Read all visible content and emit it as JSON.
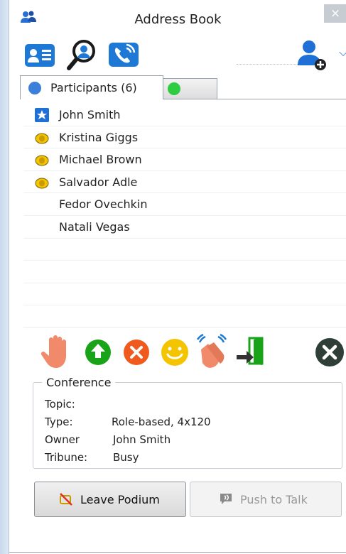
{
  "window": {
    "title": "Address Book",
    "close_label": "×"
  },
  "toolbar": {
    "buttons": [
      "contacts-card-icon",
      "search-icon",
      "call-icon"
    ],
    "add_user_icon": "add-user-icon",
    "dropdown_icon": "chevron-down-icon"
  },
  "tabs": [
    {
      "label": "Participants (6)",
      "dot_color": "#3a7fd9"
    },
    {
      "label": "",
      "dot_color": "#2ecc40"
    }
  ],
  "participants": [
    {
      "name": "John Smith",
      "icon": "star-icon"
    },
    {
      "name": "Kristina Giggs",
      "icon": "conference-role-icon"
    },
    {
      "name": "Michael Brown",
      "icon": "conference-role-icon"
    },
    {
      "name": "Salvador Adle",
      "icon": "conference-role-icon"
    },
    {
      "name": "Fedor Ovechkin",
      "icon": ""
    },
    {
      "name": "Natali Vegas",
      "icon": ""
    }
  ],
  "actions": [
    "raise-hand-icon",
    "upload-icon",
    "reject-icon",
    "smiley-icon",
    "applause-icon",
    "exit-icon",
    "close-circle-icon"
  ],
  "conference": {
    "legend": "Conference",
    "topic_label": "Topic:",
    "topic_value": "",
    "type_label": "Type:",
    "type_value": "Role-based, 4x120",
    "owner_label": "Owner",
    "owner_value": "John Smith",
    "tribune_label": "Tribune:",
    "tribune_value": "Busy"
  },
  "buttons": {
    "leave_podium": "Leave Podium",
    "push_to_talk": "Push to Talk"
  },
  "colors": {
    "accent_blue": "#1e6fd6",
    "green": "#1fa31f",
    "orange": "#f05a1e",
    "yellow": "#f5c400"
  }
}
